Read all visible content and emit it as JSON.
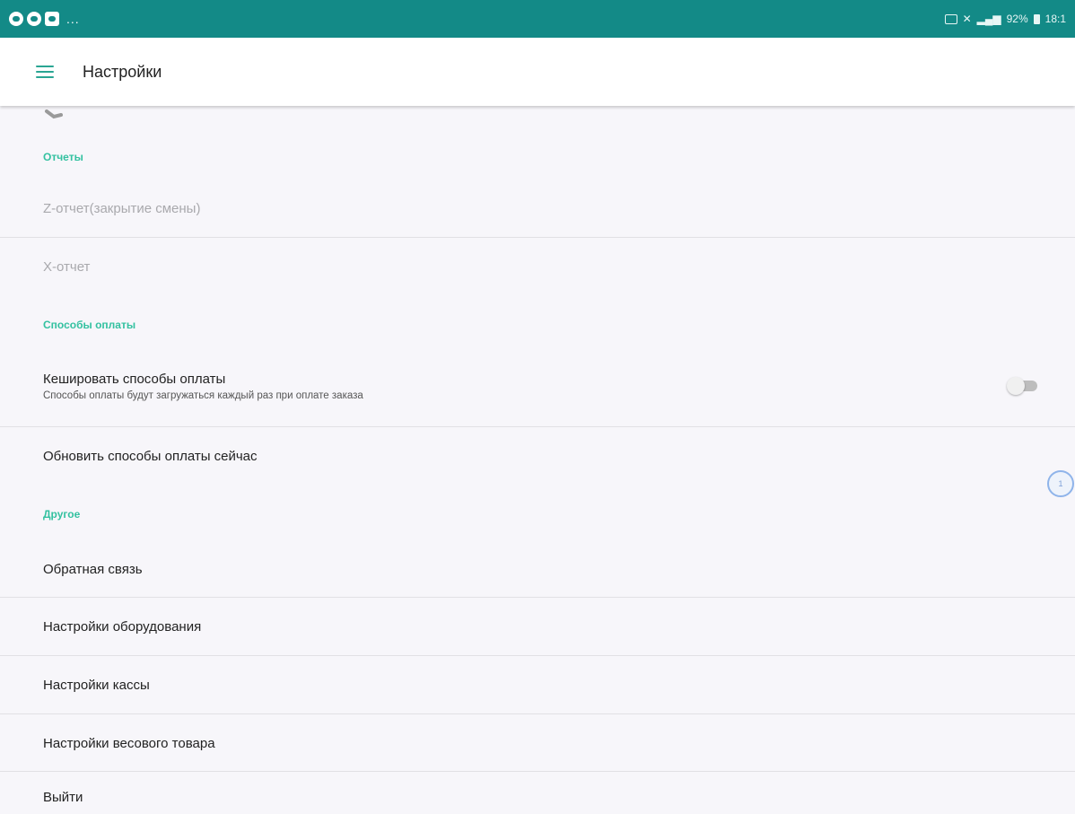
{
  "status_bar": {
    "dots": "...",
    "indicators": "92%",
    "time": "18:1"
  },
  "app_bar": {
    "title": "Настройки"
  },
  "sections": {
    "reports": {
      "header": "Отчеты",
      "z_report": "Z-отчет(закрытие смены)",
      "x_report": "X-отчет"
    },
    "payment": {
      "header": "Способы оплаты",
      "cache_title": "Кешировать способы оплаты",
      "cache_subtitle": "Способы оплаты будут загружаться каждый раз при оплате заказа",
      "cache_enabled": false,
      "refresh": "Обновить способы оплаты сейчас"
    },
    "other": {
      "header": "Другое",
      "feedback": "Обратная связь",
      "equipment": "Настройки оборудования",
      "cashbox": "Настройки кассы",
      "weight_goods": "Настройки весового товара",
      "logout": "Выйти"
    }
  },
  "floating_badge": "1",
  "colors": {
    "status_bar": "#138a87",
    "accent": "#33c1a0",
    "background": "#f7f6fa"
  }
}
